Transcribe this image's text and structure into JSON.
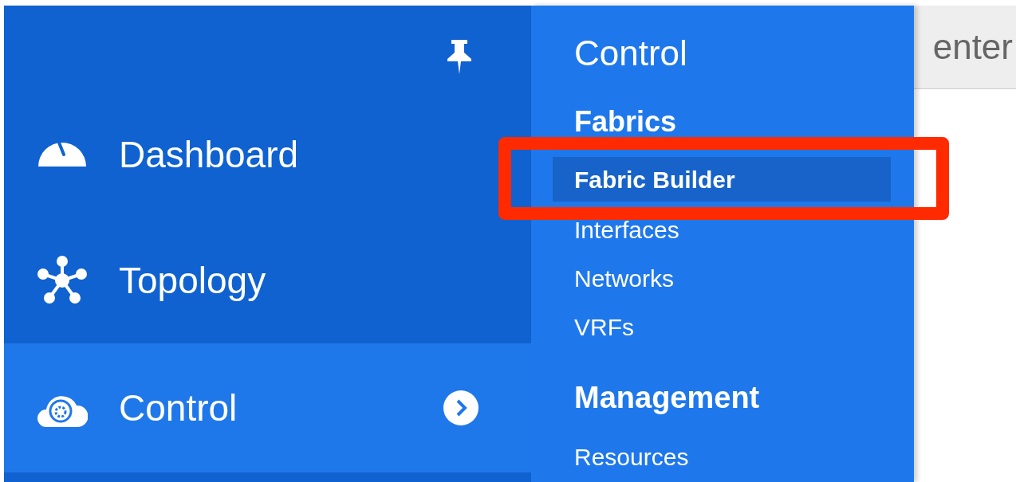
{
  "sidebar": {
    "items": [
      {
        "label": "Dashboard",
        "selected": false,
        "has_submenu": false
      },
      {
        "label": "Topology",
        "selected": false,
        "has_submenu": false
      },
      {
        "label": "Control",
        "selected": true,
        "has_submenu": true
      }
    ]
  },
  "submenu": {
    "title": "Control",
    "sections": [
      {
        "heading": "Fabrics",
        "items": [
          {
            "label": "Fabric Builder",
            "selected": true
          },
          {
            "label": "Interfaces",
            "selected": false
          },
          {
            "label": "Networks",
            "selected": false
          },
          {
            "label": "VRFs",
            "selected": false
          }
        ]
      },
      {
        "heading": "Management",
        "items": [
          {
            "label": "Resources",
            "selected": false
          }
        ]
      }
    ]
  },
  "header": {
    "title_fragment": "enter"
  }
}
